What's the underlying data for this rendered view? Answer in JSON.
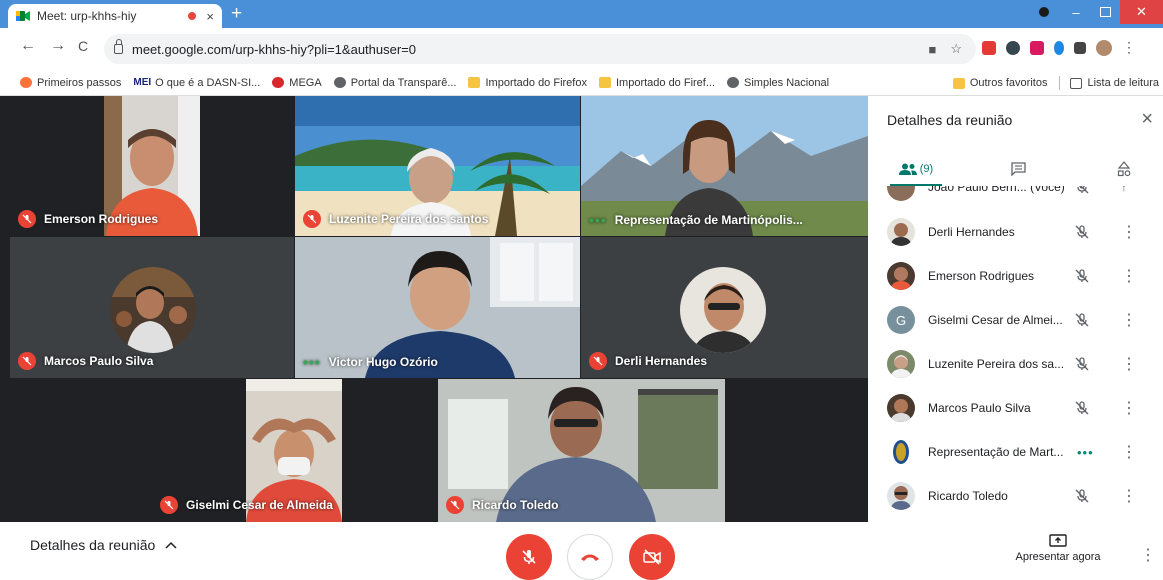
{
  "browser": {
    "tab_title": "Meet: urp-khhs-hiy",
    "tab_close": "×",
    "new_tab": "+",
    "url": "meet.google.com/urp-khhs-hiy?pli=1&authuser=0",
    "win_minimize": "–",
    "win_close": "✕",
    "back": "←",
    "forward": "→",
    "reload": "C"
  },
  "bookmarks": [
    {
      "label": "Primeiros passos",
      "icon": "firefox-icon"
    },
    {
      "label": "MEI",
      "icon": "mei-icon"
    },
    {
      "label": "O que é a DASN-SI...",
      "icon": "none"
    },
    {
      "label": "MEGA",
      "icon": "mega-icon"
    },
    {
      "label": "Portal da Transparê...",
      "icon": "globe-icon"
    },
    {
      "label": "Importado do Firefox",
      "icon": "folder-icon"
    },
    {
      "label": "Importado do Firef...",
      "icon": "folder-icon"
    },
    {
      "label": "Simples Nacional",
      "icon": "globe-icon"
    }
  ],
  "bookmarks_right": {
    "other": "Outros favoritos",
    "reading": "Lista de leitura"
  },
  "tiles": [
    {
      "name": "Emerson Rodrigues",
      "status": "muted"
    },
    {
      "name": "Luzenite Pereira dos santos",
      "status": "muted"
    },
    {
      "name": "Representação de Martinópolis...",
      "status": "speaking"
    },
    {
      "name": "Marcos Paulo Silva",
      "status": "muted"
    },
    {
      "name": "Victor Hugo Ozório",
      "status": "speaking"
    },
    {
      "name": "Derli Hernandes",
      "status": "muted"
    },
    {
      "name": "Giselmi Cesar de Almeida",
      "status": "muted"
    },
    {
      "name": "Ricardo Toledo",
      "status": "muted"
    }
  ],
  "panel": {
    "title": "Detalhes da reunião",
    "close": "×",
    "people_count": "(9)",
    "participants": [
      {
        "name": "Joao Paulo Bern... (Você)",
        "status": "muted",
        "avatar_color": "#8a6d5a"
      },
      {
        "name": "Derli Hernandes",
        "status": "muted",
        "avatar_color": "#9c6b4e"
      },
      {
        "name": "Emerson Rodrigues",
        "status": "muted",
        "avatar_color": "#6d4c41"
      },
      {
        "name": "Giselmi Cesar de Almei...",
        "status": "muted",
        "avatar_color": "#78909c",
        "initial": "G"
      },
      {
        "name": "Luzenite Pereira dos sa...",
        "status": "muted",
        "avatar_color": "#7d8a6a"
      },
      {
        "name": "Marcos Paulo Silva",
        "status": "muted",
        "avatar_color": "#5d4037"
      },
      {
        "name": "Representação de Mart...",
        "status": "speaking",
        "avatar_color": "#c9a227"
      },
      {
        "name": "Ricardo Toledo",
        "status": "muted",
        "avatar_color": "#8d9ea8"
      }
    ]
  },
  "bottom": {
    "details": "Detalhes da reunião",
    "present": "Apresentar agora"
  },
  "colors": {
    "meet_red": "#ea4335",
    "meet_teal": "#00796b",
    "stage_bg": "#202124"
  }
}
